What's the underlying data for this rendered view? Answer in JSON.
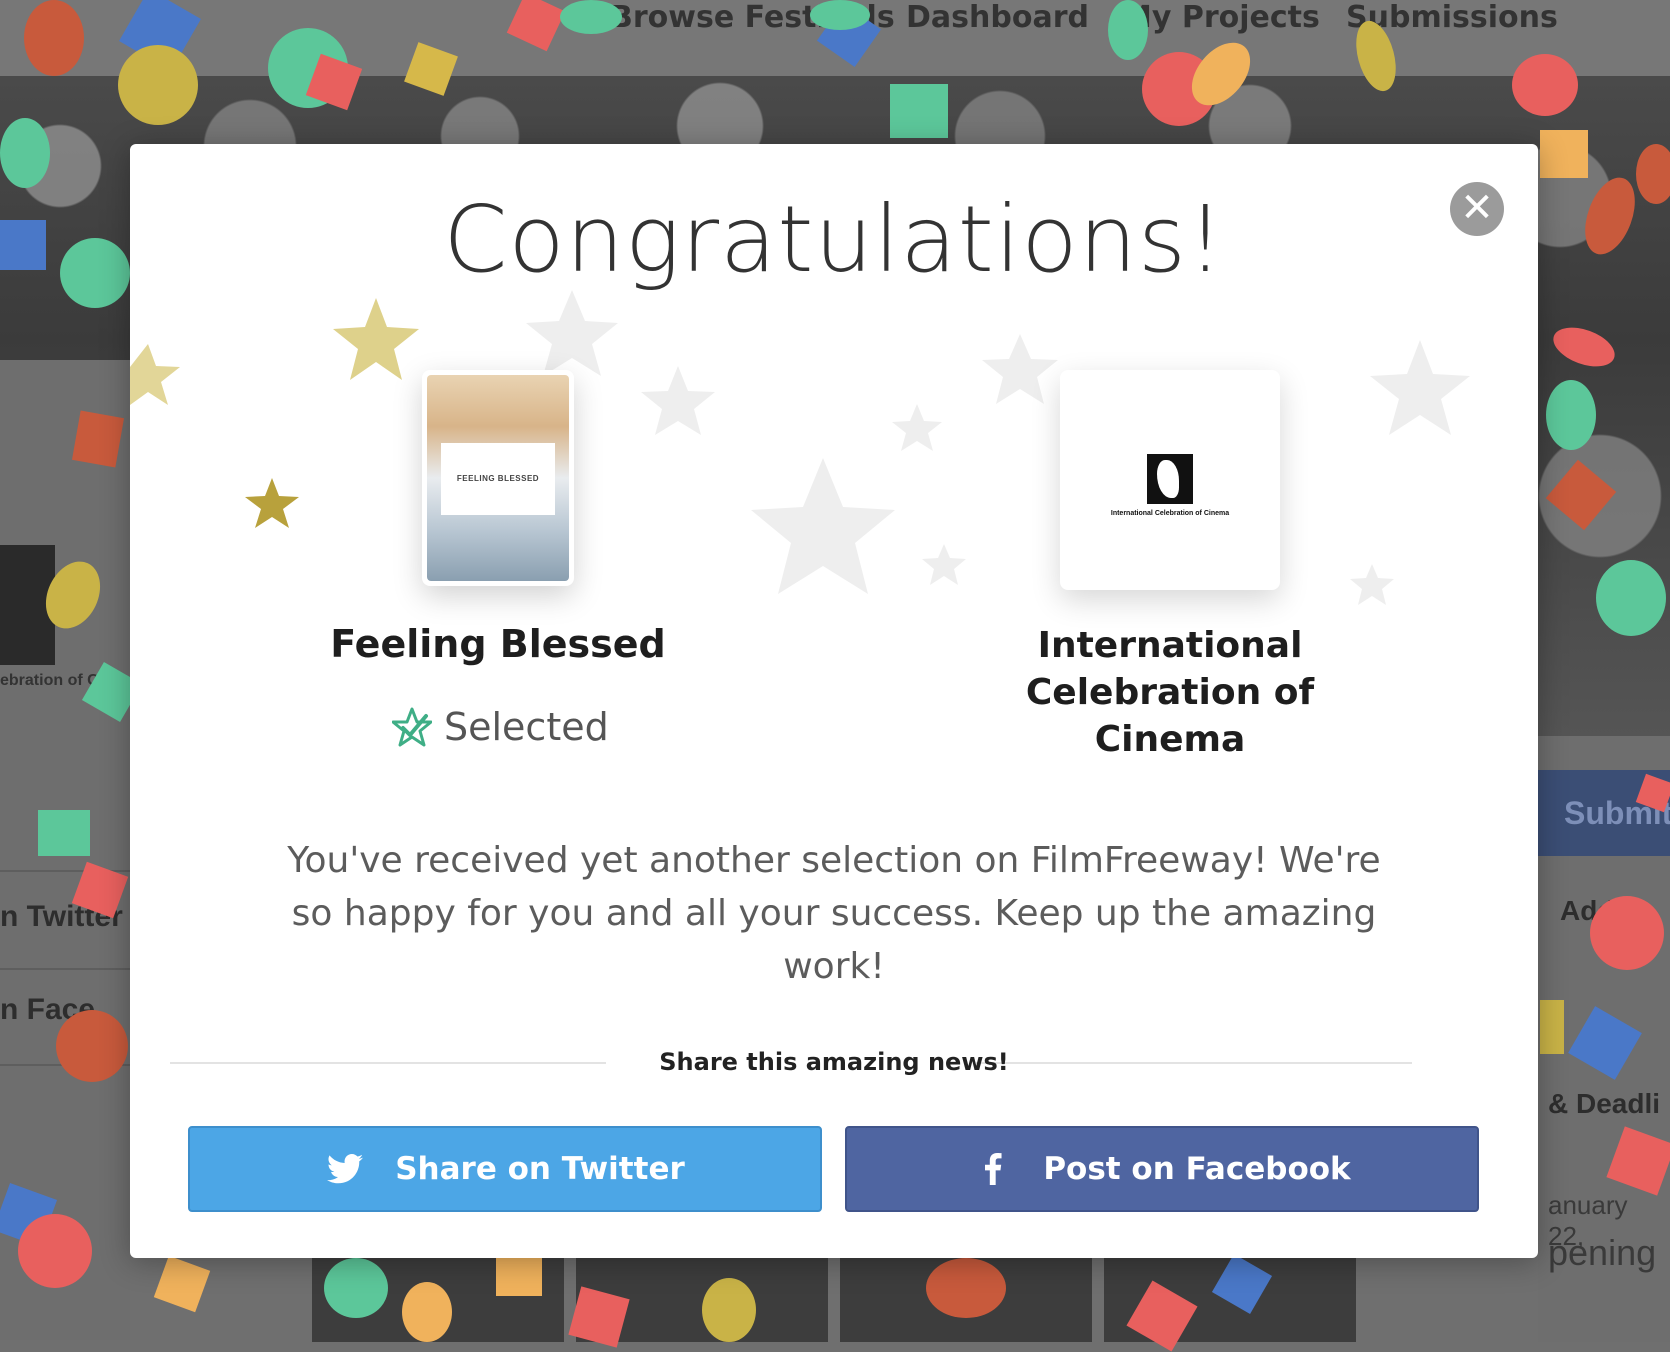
{
  "background_page": {
    "nav": [
      "Browse Festivals",
      "Dashboard",
      "My Projects",
      "Submissions"
    ],
    "left_texts": [
      "n Twitter",
      "n Face"
    ],
    "left_logo_text": "ebration of Ci",
    "right_submit": "Submit",
    "right_texts": [
      "Add",
      "& Deadli"
    ],
    "right_date": "anuary 22,",
    "right_opening": "pening"
  },
  "modal": {
    "title": "Congratulations!",
    "close_symbol": "✕",
    "project": {
      "name": "Feeling Blessed",
      "poster_text": "FEELING BLESSED",
      "status": "Selected",
      "status_icon": "star-check-icon",
      "status_color": "#3fae86"
    },
    "festival": {
      "name": "International Celebration of Cinema",
      "logo_text": "International Celebration of Cinema"
    },
    "message": "You've received yet another selection on FilmFreeway! We're so happy for you and all your success. Keep up the amazing work!",
    "share_heading": "Share this amazing news!",
    "buttons": {
      "twitter": {
        "label": "Share on Twitter",
        "icon": "twitter-icon",
        "color": "#4ca6e6"
      },
      "facebook": {
        "label": "Post on Facebook",
        "icon": "facebook-icon",
        "color": "#4f65a1"
      }
    }
  }
}
